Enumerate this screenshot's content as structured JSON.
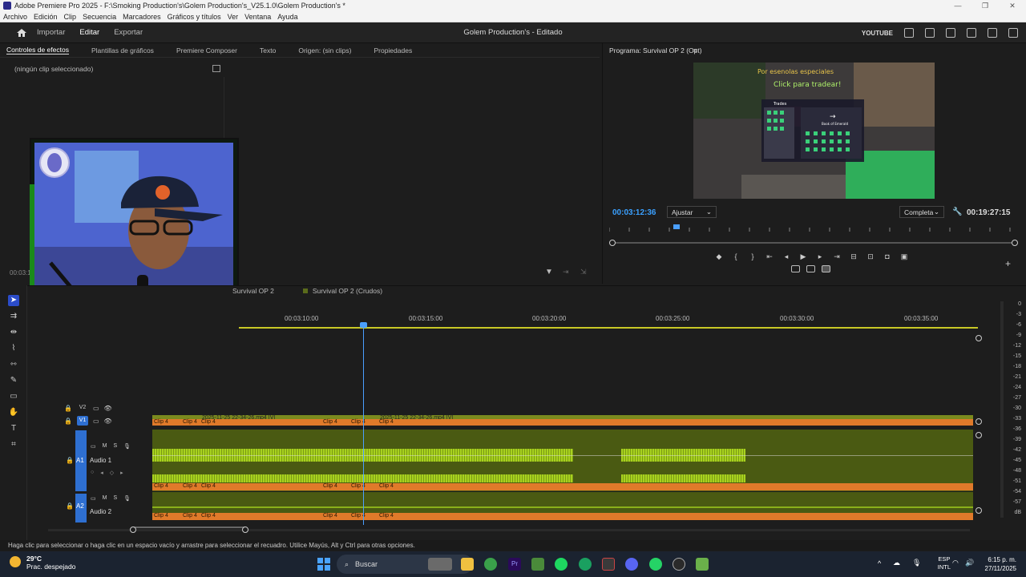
{
  "window": {
    "title": "Adobe Premiere Pro 2025 - F:\\Smoking Production's\\Golem Production's_V25.1.0\\Golem Production's *"
  },
  "menu": [
    "Archivo",
    "Edición",
    "Clip",
    "Secuencia",
    "Marcadores",
    "Gráficos y títulos",
    "Ver",
    "Ventana",
    "Ayuda"
  ],
  "header": {
    "nav": [
      "Importar",
      "Editar",
      "Exportar"
    ],
    "active": "Editar",
    "project_title": "Golem Production's - Editado",
    "right_label": "YOUTUBE"
  },
  "left_panel": {
    "tabs": [
      "Controles de efectos",
      "Plantillas de gráficos",
      "Premiere Composer",
      "Texto",
      "Origen: (sin clips)",
      "Propiedades"
    ],
    "no_clip": "(ningún clip seleccionado)",
    "timecode": "00:03:1"
  },
  "program": {
    "title": "Programa: Survival OP 2 (Opt)",
    "current_time": "00:03:12:36",
    "duration": "00:19:27:15",
    "fit": "Ajustar",
    "quality": "Completa",
    "game_texts": [
      "Por esenolas especiales",
      "Click para tradear!",
      "Trades",
      "Book of Emerald"
    ]
  },
  "timeline": {
    "sequence_tabs": [
      "Survival OP 2",
      "Survival OP 2 (Crudos)"
    ],
    "ruler": [
      "00:03:10:00",
      "00:03:15:00",
      "00:03:20:00",
      "00:03:25:00",
      "00:03:30:00",
      "00:03:35:00"
    ],
    "tracks": {
      "v2": "V2",
      "v1": "V1",
      "a1": "A1",
      "a1_name": "Audio 1",
      "a2": "A2",
      "a2_name": "Audio 2"
    },
    "clip_label": "Clip 4",
    "video_clip_name": "2025-11-25 22-34-26.mp4 [V]",
    "meter_labels": [
      "0",
      "-3",
      "-6",
      "-9",
      "-12",
      "-15",
      "-18",
      "-21",
      "-24",
      "-27",
      "-30",
      "-33",
      "-36",
      "-39",
      "-42",
      "-45",
      "-48",
      "-51",
      "-54",
      "-57",
      "dB"
    ]
  },
  "status": "Haga clic para seleccionar o haga clic en un espacio vacío y arrastre para seleccionar el recuadro. Utilice Mayús, Alt y Ctrl para otras opciones.",
  "taskbar": {
    "temp": "29°C",
    "weather": "Prac. despejado",
    "search": "Buscar",
    "lang1": "ESP",
    "lang2": "INTL",
    "time": "6:15 p. m.",
    "date": "27/11/2025"
  }
}
